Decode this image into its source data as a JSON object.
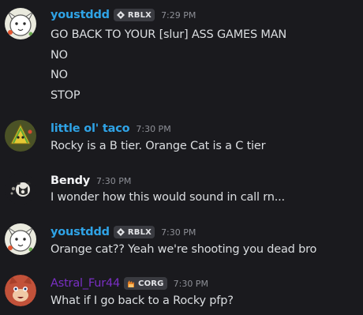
{
  "colors": {
    "background": "#1a1a1e",
    "message_text": "#dbdee1",
    "timestamp": "#8d8f96",
    "tag_background": "#3a3b41",
    "username_blue": "#2fa3e6",
    "username_white": "#f2f3f5",
    "username_purple": "#7a2fc4"
  },
  "messages": [
    {
      "username": "youstddd",
      "username_color": "#2fa3e6",
      "tag": {
        "icon": "rblx-badge-icon",
        "label": "RBLX"
      },
      "timestamp": "7:29 PM",
      "lines": [
        "GO BACK TO YOUR [slur] ASS GAMES MAN",
        "NO",
        "NO",
        "STOP"
      ]
    },
    {
      "username": "little ol' taco",
      "username_color": "#2fa3e6",
      "timestamp": "7:30 PM",
      "lines": [
        "Rocky is a B tier. Orange Cat is a C tier"
      ]
    },
    {
      "username": "Bendy",
      "username_color": "#f2f3f5",
      "timestamp": "7:30 PM",
      "lines": [
        "I wonder how this would sound in call rn..."
      ]
    },
    {
      "username": "youstddd",
      "username_color": "#2fa3e6",
      "tag": {
        "icon": "rblx-badge-icon",
        "label": "RBLX"
      },
      "timestamp": "7:30 PM",
      "lines": [
        "Orange cat?? Yeah we're shooting you dead bro"
      ]
    },
    {
      "username": "Astral_Fur44",
      "username_color": "#7a2fc4",
      "tag": {
        "icon": "corg-badge-icon",
        "label": "CORG"
      },
      "timestamp": "7:30 PM",
      "lines": [
        "What if I go back to a Rocky pfp?"
      ]
    }
  ]
}
